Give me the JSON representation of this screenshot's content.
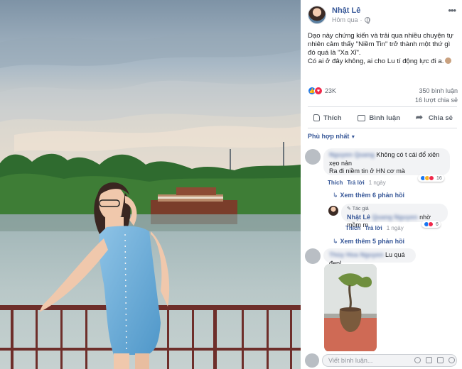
{
  "post": {
    "author": "Nhật Lê",
    "time": "Hôm qua",
    "caption_lines": [
      "Dạo này chứng kiến và trải qua nhiều chuyện tự nhiên cảm thấy \"Niềm Tin\" trở thành một thứ gì đó quá là \"Xa Xỉ\".",
      "Có ai ở đây không, ai cho Lu tí động lực đi a."
    ],
    "reaction_count": "23K",
    "comment_count": "350 bình luận",
    "share_count": "16 lượt chia sẻ",
    "sort_label": "Phù hợp nhất",
    "actions": {
      "like": "Thích",
      "comment": "Bình luận",
      "share": "Chia sẻ"
    }
  },
  "comments": [
    {
      "name": "Nguyen Quang",
      "text_line1": "Không có t cái đổ xiên xẹo nản",
      "text_line2": "Ra đi niềm tin ở HN cơ mà",
      "like": "Thích",
      "reply": "Trả lời",
      "time": "1 ngày",
      "reaction_count": "16",
      "more_replies": "Xem thêm 6 phản hồi"
    },
    {
      "tag": "Tác giả",
      "name": "Nhật Lê",
      "name_blurred": "Quang Nguyen",
      "text": "nhờ mồm m",
      "like": "Thích",
      "reply": "Trả lời",
      "time": "1 ngày",
      "reaction_count": "6",
      "more_replies": "Xem thêm 5 phản hồi"
    },
    {
      "name": "Thùy Hoa Nguyen",
      "text": "Lu quá đẹp!"
    }
  ],
  "composer": {
    "placeholder": "Viết bình luận..."
  },
  "colors": {
    "link": "#385898",
    "like_blue": "#1877f2",
    "love_red": "#f0284a"
  }
}
